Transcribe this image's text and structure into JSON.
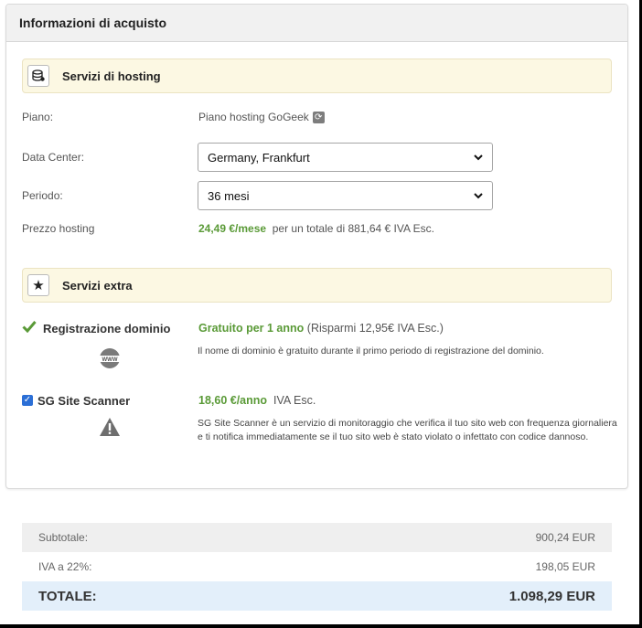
{
  "panel": {
    "title": "Informazioni di acquisto"
  },
  "hosting": {
    "section_title": "Servizi di hosting",
    "icon": "database-icon",
    "plan_label": "Piano:",
    "plan_value": "Piano hosting GoGeek",
    "datacenter_label": "Data Center:",
    "datacenter_value": "Germany, Frankfurt",
    "period_label": "Periodo:",
    "period_value": "36 mesi",
    "price_label": "Prezzo hosting",
    "price_value": "24,49 €/mese",
    "price_suffix": "per un totale di 881,64 € IVA Esc."
  },
  "extra": {
    "section_title": "Servizi extra",
    "icon": "star-icon",
    "domain": {
      "name": "Registrazione dominio",
      "price": "Gratuito per 1 anno",
      "savings": "(Risparmi 12,95€ IVA Esc.)",
      "description": "Il nome di dominio è gratuito durante il primo periodo di registrazione del dominio.",
      "icon_text": "WWW"
    },
    "scanner": {
      "name": "SG Site Scanner",
      "price": "18,60 €/anno",
      "price_suffix": "IVA Esc.",
      "description": "SG Site Scanner è un servizio di monitoraggio che verifica il tuo sito web con frequenza giornaliera e ti notifica immediatamente se il tuo sito web è stato violato o infettato con codice dannoso.",
      "checked": true
    }
  },
  "summary": {
    "subtotal_label": "Subtotale:",
    "subtotal_value": "900,24 EUR",
    "vat_label": "IVA a 22%:",
    "vat_value": "198,05 EUR",
    "total_label": "TOTALE:",
    "total_value": "1.098,29 EUR"
  },
  "colors": {
    "accent_green": "#5a9a37",
    "section_bg": "#fcf8e3",
    "total_bg": "#e3effa",
    "checkbox_blue": "#2b6fd6"
  }
}
